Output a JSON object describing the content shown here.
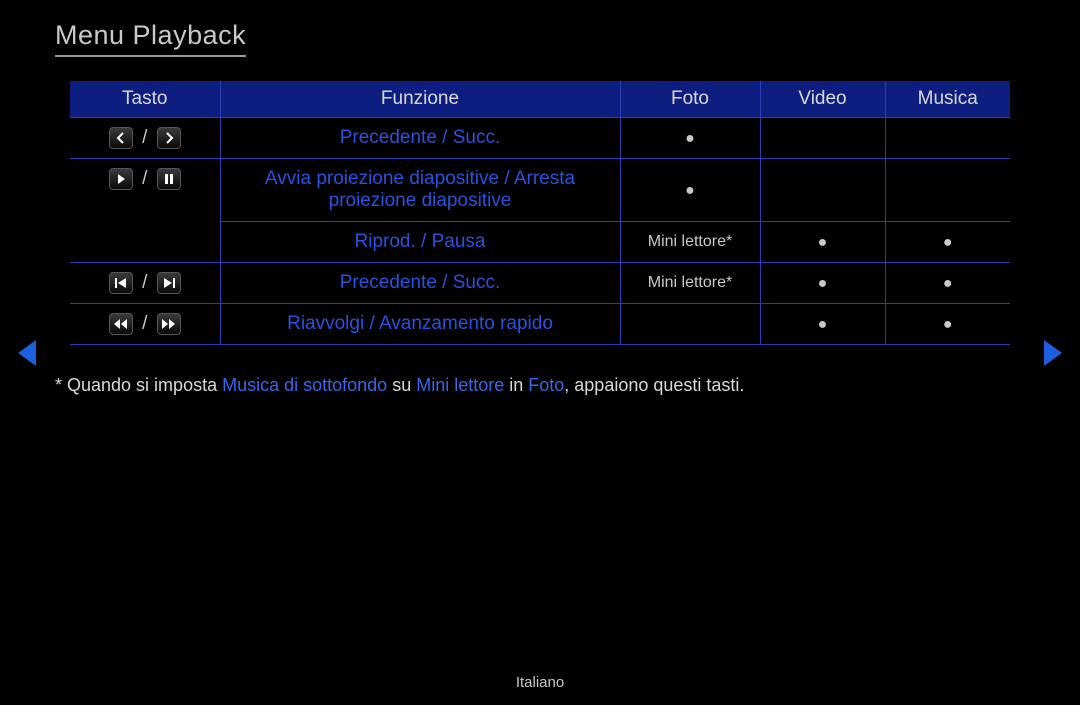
{
  "title": "Menu Playback",
  "headers": {
    "key": "Tasto",
    "func": "Funzione",
    "foto": "Foto",
    "video": "Video",
    "musica": "Musica"
  },
  "rows": [
    {
      "func": "Precedente / Succ.",
      "foto_dot": "●",
      "video": "",
      "musica": ""
    },
    {
      "func": "Avvia proiezione diapositive / Arresta proiezione diapositive",
      "foto_dot": "●",
      "video": "",
      "musica": ""
    },
    {
      "func": "Riprod. / Pausa",
      "foto_text": "Mini lettore*",
      "video_dot": "●",
      "musica_dot": "●"
    },
    {
      "func": "Precedente / Succ.",
      "foto_text": "Mini lettore*",
      "video_dot": "●",
      "musica_dot": "●"
    },
    {
      "func": "Riavvolgi / Avanzamento rapido",
      "foto": "",
      "video_dot": "●",
      "musica_dot": "●"
    }
  ],
  "footnote": {
    "pre": "* Quando si imposta ",
    "hl1": "Musica di sottofondo",
    "mid1": " su ",
    "hl2": "Mini lettore",
    "mid2": " in ",
    "hl3": "Foto",
    "post": ", appaiono questi tasti."
  },
  "language": "Italiano"
}
